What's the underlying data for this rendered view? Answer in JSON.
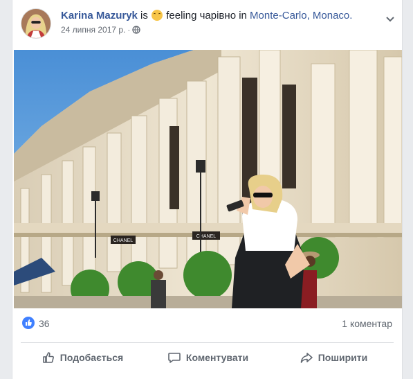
{
  "post": {
    "author": "Karina Mazuryk",
    "is_text": "is",
    "feeling_text": "feeling чарівно in",
    "location": "Monte-Carlo, Monaco.",
    "date": "24 липня 2017 р.",
    "dot": "·",
    "feeling_icon": "smiling-face-emoji",
    "audience_icon": "globe-icon"
  },
  "photo": {
    "signs": [
      "CHANEL",
      "CHANEL"
    ]
  },
  "stats": {
    "likes": "36",
    "comments": "1 коментар"
  },
  "actions": {
    "like": "Подобається",
    "comment": "Коментувати",
    "share": "Поширити"
  },
  "colors": {
    "link": "#365899",
    "like_blue": "#4080ff",
    "muted": "#606770"
  }
}
